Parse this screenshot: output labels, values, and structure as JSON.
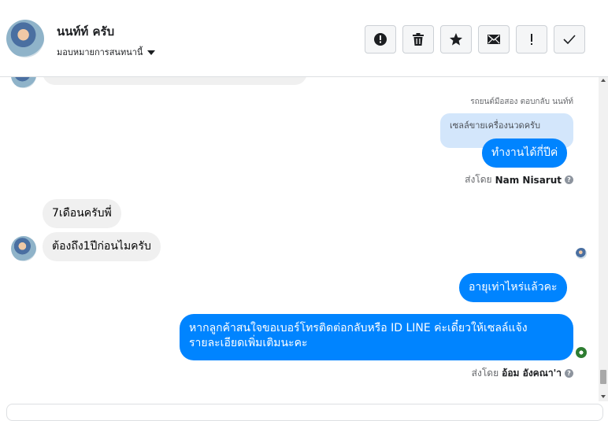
{
  "header": {
    "contact_name": "นนท์ท์ ครับ",
    "assign_label": "มอบหมายการสนทนานี้"
  },
  "toolbar": {
    "buttons": [
      {
        "name": "mark-spam-button",
        "icon": "alert-circle-icon"
      },
      {
        "name": "delete-button",
        "icon": "trash-icon"
      },
      {
        "name": "star-button",
        "icon": "star-icon"
      },
      {
        "name": "mark-unread-button",
        "icon": "envelope-icon"
      },
      {
        "name": "follow-up-button",
        "icon": "exclamation-icon"
      },
      {
        "name": "mark-done-button",
        "icon": "check-icon"
      }
    ]
  },
  "messages": {
    "reply_note": "รถยนต์มือสอง ตอบกลับ นนท์ท์",
    "quoted_text": "เซลล์ขายเครื่องนวดครับ",
    "out1": "ทำงานได้กี่ปีค่",
    "sent_by_label_1": "ส่งโดย",
    "sent_by_name_1": "Nam Nisarut",
    "in1": "7เดือนครับพี่",
    "in2": "ต้องถึง1ปีก่อนไมครับ",
    "out2": "อายุเท่าไหร่แล้วคะ",
    "out3_line1": "หากลูกค้าสนใจขอเบอร์โทรติดต่อกลับหรือ ID LINE ค่ะเดี๋ยวให้เซลล์แจ้ง",
    "out3_line2": "รายละเอียดเพิ่มเติมนะคะ",
    "sent_by_label_2": "ส่งโดย",
    "sent_by_name_2": "อ้อม อังคณา'า"
  },
  "colors": {
    "outgoing_bubble": "#0084ff",
    "incoming_bubble": "#f0f0f0",
    "quoted_bubble": "#d3e6fb"
  }
}
